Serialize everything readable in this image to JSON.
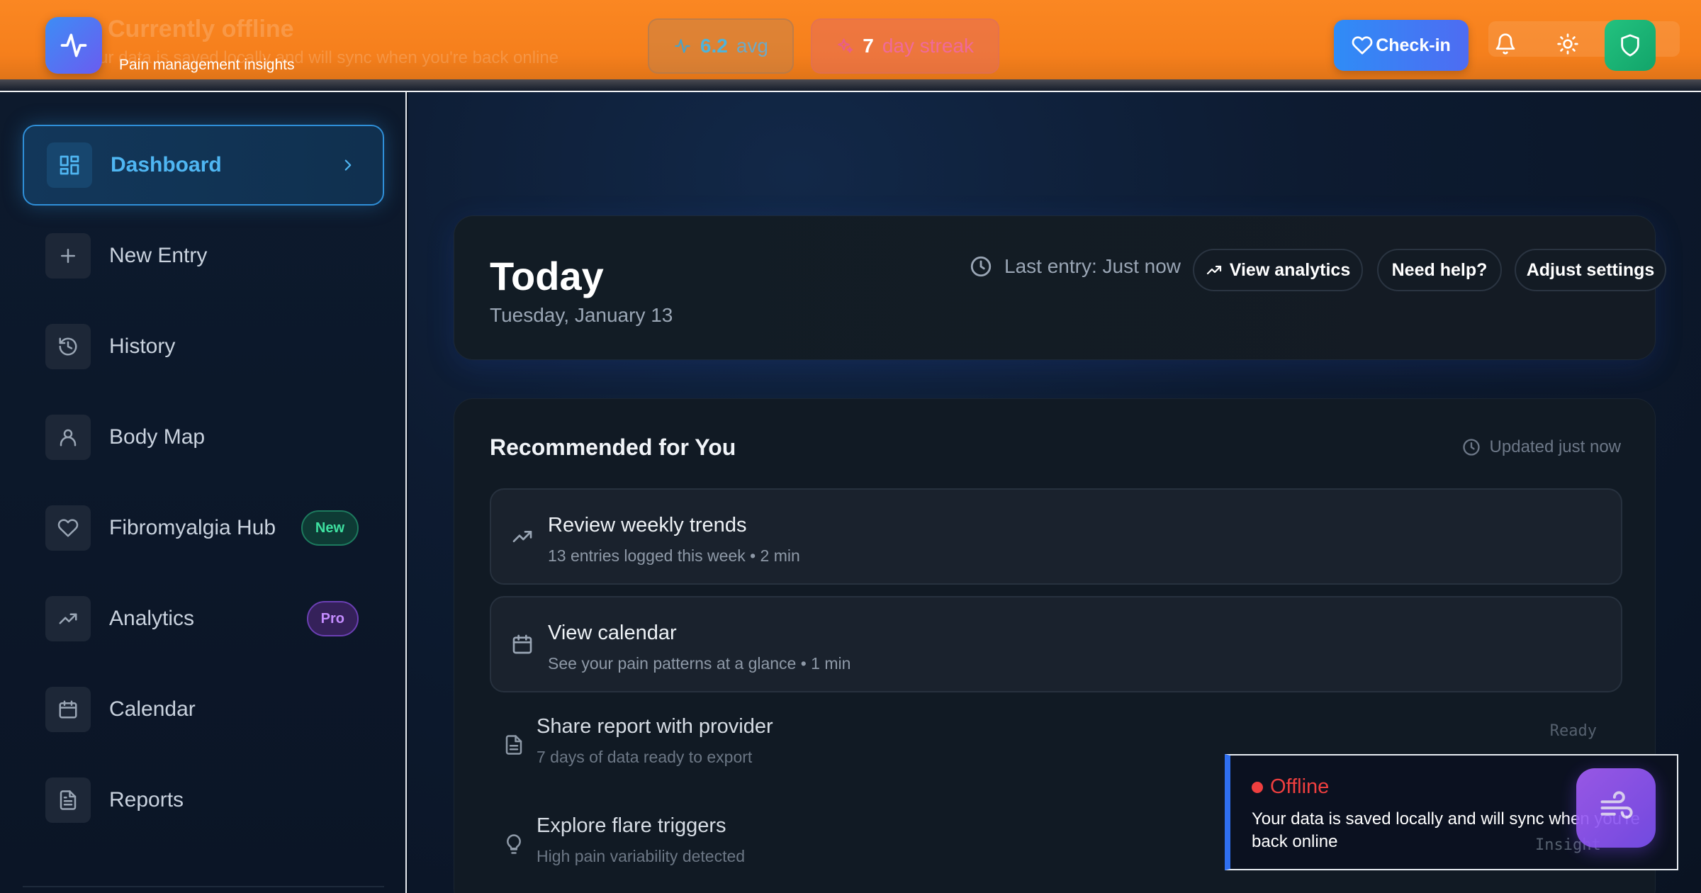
{
  "header": {
    "ghost_title": "Currently offline",
    "ghost_text": "Your data is saved locally and will sync when you're back online",
    "tagline": "Pain management insights",
    "avg_value": "6.2",
    "avg_label": "avg",
    "streak_value": "7",
    "streak_label": "day streak",
    "checkin_label": "Check-in"
  },
  "sidebar": {
    "items": [
      {
        "label": "Dashboard"
      },
      {
        "label": "New Entry"
      },
      {
        "label": "History"
      },
      {
        "label": "Body Map"
      },
      {
        "label": "Fibromyalgia Hub",
        "badge": "New"
      },
      {
        "label": "Analytics",
        "badge": "Pro"
      },
      {
        "label": "Calendar"
      },
      {
        "label": "Reports"
      }
    ]
  },
  "today": {
    "title": "Today",
    "date": "Tuesday, January 13",
    "last_entry": "Last entry: Just now",
    "view_analytics": "View analytics",
    "need_help": "Need help?",
    "adjust_settings": "Adjust settings"
  },
  "recommended": {
    "title": "Recommended for You",
    "updated": "Updated just now",
    "rows": [
      {
        "title": "Review weekly trends",
        "sub": "13 entries logged this week • 2 min"
      },
      {
        "title": "View calendar",
        "sub": "See your pain patterns at a glance • 1 min"
      },
      {
        "title": "Share report with provider",
        "sub": "7 days of data ready to export",
        "status": "Ready"
      },
      {
        "title": "Explore flare triggers",
        "sub": "High pain variability detected",
        "status": "Insight"
      }
    ]
  },
  "toast": {
    "title": "Offline",
    "text": "Your data is saved locally and will sync when you're back online"
  },
  "colors": {
    "header_orange": "#f98220",
    "accent_blue": "#2f8cf6",
    "success_green": "#23c27f",
    "offline_red": "#ef3f3f",
    "pro_purple": "#c48cff"
  }
}
